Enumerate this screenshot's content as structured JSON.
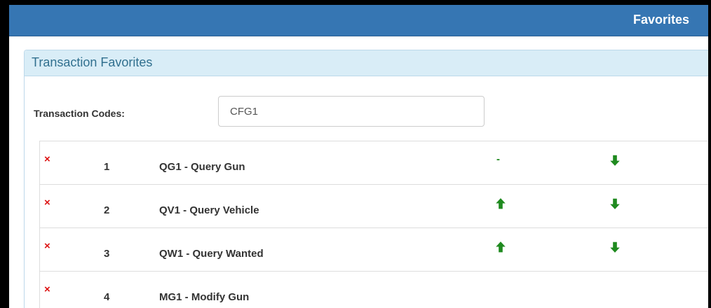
{
  "header": {
    "title": "Favorites"
  },
  "panel": {
    "title": "Transaction Favorites"
  },
  "form": {
    "codes_label": "Transaction Codes:",
    "codes_value": "CFG1"
  },
  "favorites": [
    {
      "delete_icon": "×",
      "number": "1",
      "name": "QG1 - Query Gun",
      "up": "none",
      "up_text": "-",
      "down": "arrow-down"
    },
    {
      "delete_icon": "×",
      "number": "2",
      "name": "QV1 - Query Vehicle",
      "up": "arrow-up",
      "down": "arrow-down"
    },
    {
      "delete_icon": "×",
      "number": "3",
      "name": "QW1 - Query Wanted",
      "up": "arrow-up",
      "down": "arrow-down"
    },
    {
      "delete_icon": "×",
      "number": "4",
      "name": "MG1 - Modify Gun",
      "up": "none",
      "down": "none"
    }
  ],
  "colors": {
    "header_bg": "#3676b3",
    "panel_heading_bg": "#d9edf7",
    "panel_heading_text": "#31708f",
    "delete_red": "#dd1111",
    "arrow_green": "#1f8a1f"
  }
}
